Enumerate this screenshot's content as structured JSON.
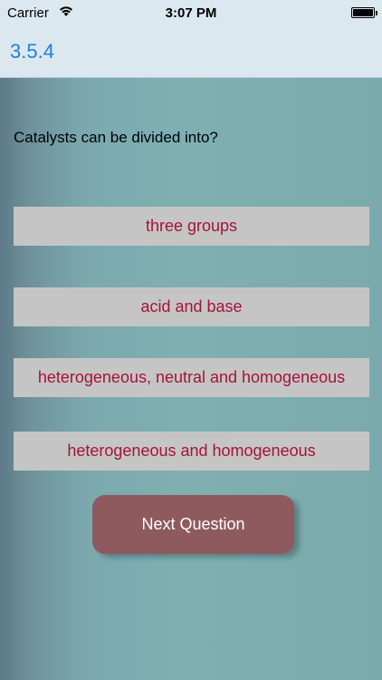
{
  "status_bar": {
    "carrier": "Carrier",
    "time": "3:07 PM",
    "wifi_icon": "wifi-icon",
    "battery_icon": "battery-icon"
  },
  "nav": {
    "title": "3.5.4"
  },
  "question": "Catalysts can be divided into?",
  "answers": [
    "three groups",
    "acid and base",
    "heterogeneous, neutral and homogeneous",
    "heterogeneous and homogeneous"
  ],
  "next_button": "Next Question",
  "colors": {
    "nav_title": "#1f7ee6",
    "answer_text": "#a51240",
    "answer_bg": "#c5c5c5",
    "next_button_bg": "#8f5a5e"
  }
}
